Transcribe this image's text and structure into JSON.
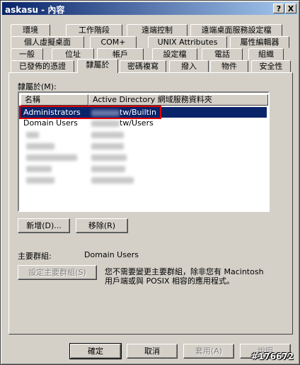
{
  "window": {
    "title": "askasu - 內容",
    "help_btn": "?",
    "close_btn": "X"
  },
  "tabs": {
    "row1": [
      "環境",
      "工作階段",
      "遠端控制",
      "遠端桌面服務設定檔"
    ],
    "row2": [
      "個人虛擬桌面",
      "COM+",
      "UNIX Attributes",
      "屬性編輯器"
    ],
    "row3": [
      "一般",
      "位址",
      "帳戶",
      "設定檔",
      "電話",
      "組織"
    ],
    "row4": [
      "已發佈的憑證",
      "隸屬於",
      "密碼複寫",
      "撥入",
      "物件",
      "安全性"
    ]
  },
  "member_of": {
    "label": "隸屬於(M):",
    "columns": [
      "名稱",
      "Active Directory 網域服務資料夾"
    ],
    "rows": [
      {
        "name": "Administrators",
        "folder": "tw/Builtin",
        "selected": true
      },
      {
        "name": "Domain Users",
        "folder": "tw/Users",
        "selected": false
      }
    ],
    "add_btn": "新增(D)...",
    "remove_btn": "移除(R)"
  },
  "primary_group": {
    "label": "主要群組:",
    "value": "Domain Users",
    "set_btn": "設定主要群組(S)",
    "note_line1": "您不需要變更主要群組，除非您有 Macintosh",
    "note_line2": "用戶端或與 POSIX 相容的應用程式。"
  },
  "footer": {
    "ok": "確定",
    "cancel": "取消",
    "apply": "套用(A)",
    "help": "說明"
  },
  "watermark": "#176672",
  "colors": {
    "title_start": "#0a246a",
    "title_end": "#a6caf0",
    "selection": "#0a246a",
    "highlight_box": "#e00000"
  }
}
